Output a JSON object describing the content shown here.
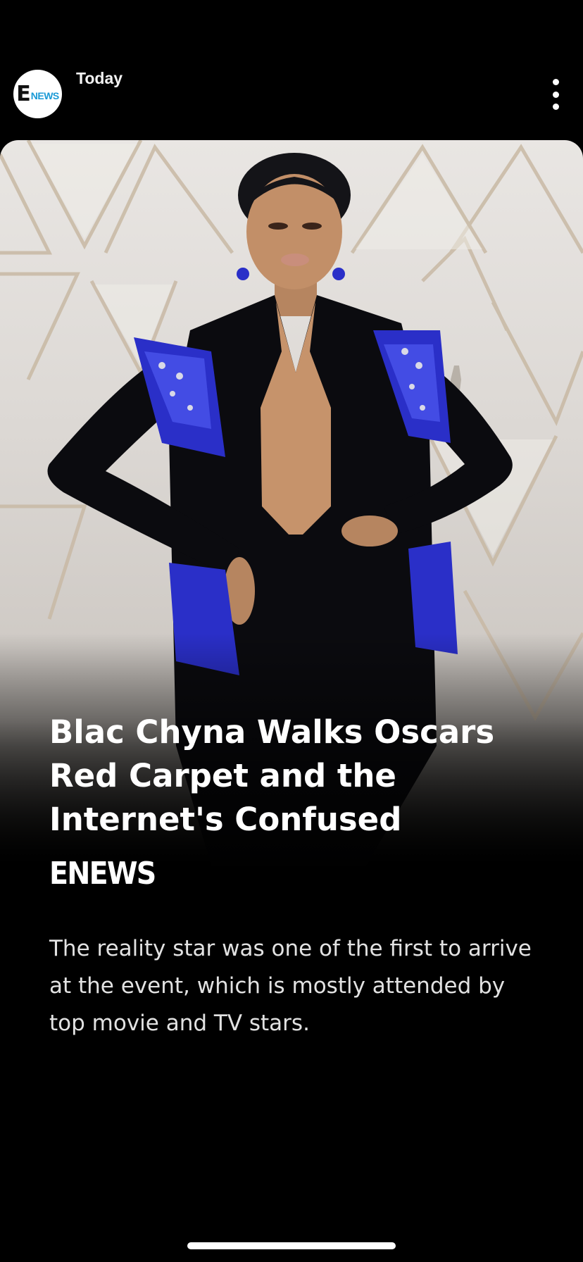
{
  "publisher": {
    "logo_letter": "E",
    "logo_word": "NEWS",
    "timestamp": "Today",
    "more_icon": "vertical-ellipsis-icon"
  },
  "story": {
    "headline": "Blac Chyna Walks Oscars Red Carpet and the Internet's Confused",
    "brand": "ENEWS",
    "summary": "The reality star was one of the first to arrive at the event, which is mostly attended by top movie and TV stars."
  },
  "colors": {
    "background": "#000000",
    "text_primary": "#ffffff",
    "text_secondary": "#e2e2e2",
    "logo_accent": "#1a9ad6",
    "gown": "#0b0b0f",
    "beadwork": "#2a2fc8"
  }
}
